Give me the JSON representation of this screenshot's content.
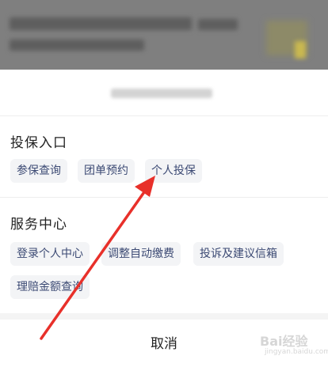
{
  "sections": [
    {
      "title": "投保入口",
      "items": [
        "参保查询",
        "团单预约",
        "个人投保"
      ]
    },
    {
      "title": "服务中心",
      "items": [
        "登录个人中心",
        "调整自动缴费",
        "投诉及建议信箱",
        "理赔金额查询"
      ]
    }
  ],
  "cancel_label": "取消",
  "watermark": {
    "brand": "Bai经验",
    "sub": "jingyan.baidu.com"
  },
  "annotation": {
    "type": "red-arrow",
    "target": "个人投保",
    "color": "#e8302a"
  },
  "colors": {
    "chip_bg": "#f3f4f6",
    "chip_text": "#3c4a74",
    "backdrop": "#7f7f7f"
  }
}
